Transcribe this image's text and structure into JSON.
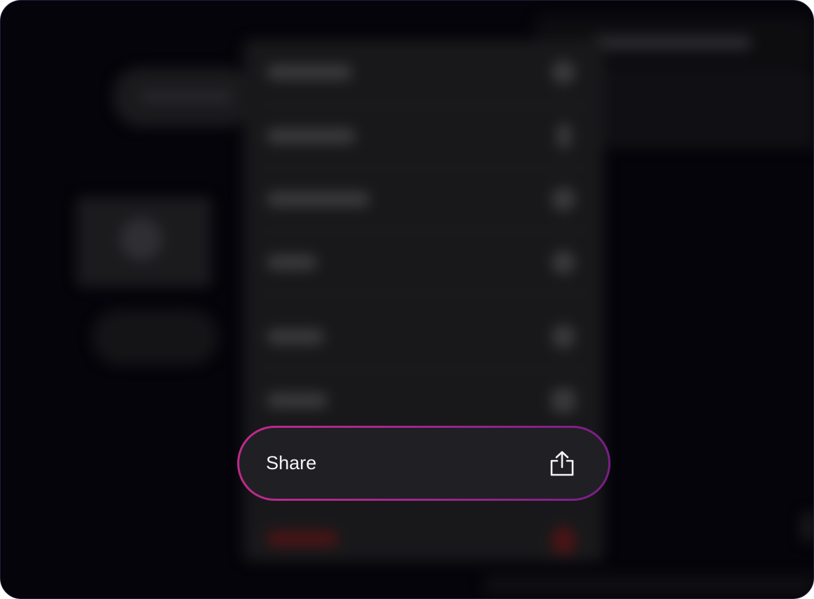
{
  "context_menu": {
    "focused_item": {
      "label": "Share",
      "icon": "share-icon"
    },
    "blurred_items": [
      {
        "name": "menu-item-1",
        "icon": "info-icon"
      },
      {
        "name": "menu-item-2",
        "icon": "pencil-icon"
      },
      {
        "name": "menu-item-3",
        "icon": "duplicate-icon"
      },
      {
        "name": "menu-item-4",
        "icon": "tag-icon"
      },
      {
        "name": "menu-item-5",
        "icon": "chat-icon"
      },
      {
        "name": "menu-item-6",
        "icon": "folder-icon"
      },
      {
        "name": "menu-item-delete",
        "icon": "trash-icon",
        "tone": "destructive"
      }
    ]
  },
  "colors": {
    "backdrop": "#04040a",
    "menu_background": "#18181a",
    "focused_item_background": "#1f1f24",
    "focus_ring_start": "#c02a8a",
    "focus_ring_end": "#7b1e86",
    "destructive": "#4a1416",
    "text": "#f4f4f6"
  }
}
